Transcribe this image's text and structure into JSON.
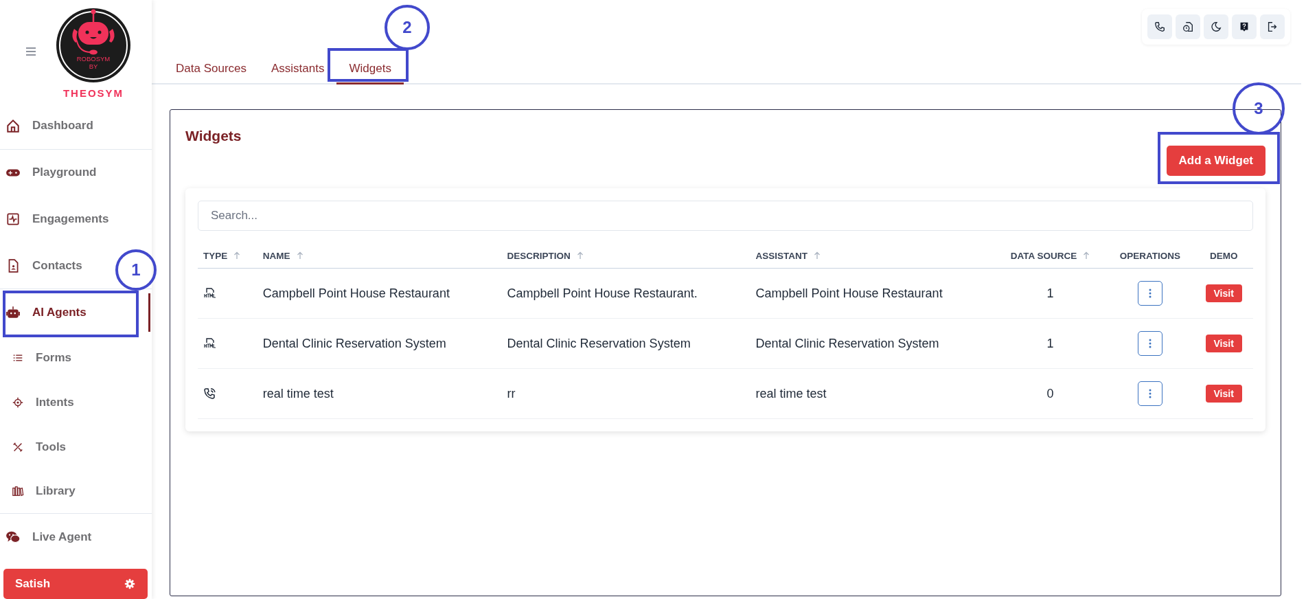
{
  "sidebar": {
    "logo": {
      "lines": [
        "ROBOSYM",
        "BY"
      ],
      "wordmark": "THEOSYM"
    },
    "items": [
      {
        "label": "Dashboard",
        "selected": false,
        "divider_after": true
      },
      {
        "label": "Playground",
        "selected": false,
        "divider_after": false
      },
      {
        "label": "Engagements",
        "selected": false,
        "divider_after": false
      },
      {
        "label": "Contacts",
        "selected": false,
        "divider_after": true
      },
      {
        "label": "AI Agents",
        "selected": true,
        "divider_after": false
      },
      {
        "label": "Forms",
        "selected": false,
        "divider_after": false
      },
      {
        "label": "Intents",
        "selected": false,
        "divider_after": false
      },
      {
        "label": "Tools",
        "selected": false,
        "divider_after": false
      },
      {
        "label": "Library",
        "selected": false,
        "divider_after": true
      },
      {
        "label": "Live Agent",
        "selected": false,
        "divider_after": false
      }
    ],
    "user": {
      "name": "Satish"
    }
  },
  "tabs": [
    {
      "label": "Data Sources",
      "selected": false
    },
    {
      "label": "Assistants",
      "selected": false
    },
    {
      "label": "Widgets",
      "selected": true
    }
  ],
  "panel": {
    "title": "Widgets",
    "add_button": "Add a Widget",
    "search": {
      "placeholder": "Search..."
    },
    "table": {
      "columns": [
        {
          "label": "TYPE",
          "sortable": true
        },
        {
          "label": "NAME",
          "sortable": true
        },
        {
          "label": "DESCRIPTION",
          "sortable": true
        },
        {
          "label": "ASSISTANT",
          "sortable": true
        },
        {
          "label": "DATA SOURCE",
          "sortable": true
        },
        {
          "label": "OPERATIONS",
          "sortable": false
        },
        {
          "label": "DEMO",
          "sortable": false
        }
      ],
      "rows": [
        {
          "kind": "html",
          "name": "Campbell Point House Restaurant",
          "description": "Campbell Point House Restaurant.",
          "assistant": "Campbell Point House Restaurant",
          "data_source": "1",
          "demo": "Visit"
        },
        {
          "kind": "html",
          "name": "Dental Clinic Reservation System",
          "description": "Dental Clinic Reservation System",
          "assistant": "Dental Clinic Reservation System",
          "data_source": "1",
          "demo": "Visit"
        },
        {
          "kind": "call",
          "name": "real time test",
          "description": "rr",
          "assistant": "real time test",
          "data_source": "0",
          "demo": "Visit"
        }
      ]
    }
  },
  "annotations": [
    {
      "label": "1"
    },
    {
      "label": "2"
    },
    {
      "label": "3"
    }
  ]
}
